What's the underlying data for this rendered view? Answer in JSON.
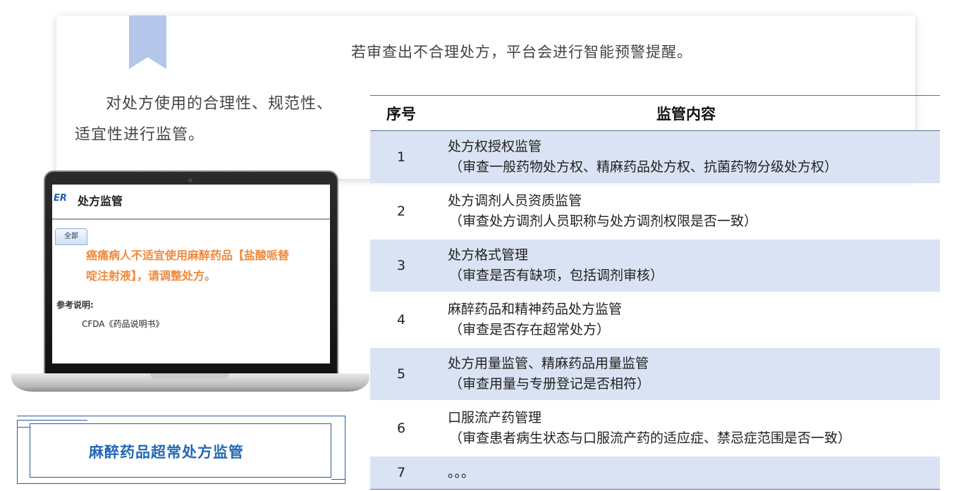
{
  "card": {
    "warning_text": "若审查出不合理处方，平台会进行智能预警提醒。",
    "intro_text": "对处方使用的合理性、规范性、适宜性进行监管。"
  },
  "table": {
    "header_num": "序号",
    "header_content": "监管内容",
    "rows": [
      {
        "num": "1",
        "title": "处方权授权监管",
        "detail": "（审查一般药物处方权、精麻药品处方权、抗菌药物分级处方权）"
      },
      {
        "num": "2",
        "title": "处方调剂人员资质监管",
        "detail": "（审查处方调剂人员职称与处方调剂权限是否一致）"
      },
      {
        "num": "3",
        "title": "处方格式管理",
        "detail": "（审查是否有缺项，包括调剂审核）"
      },
      {
        "num": "4",
        "title": "麻醉药品和精神药品处方监管",
        "detail": "（审查是否存在超常处方）"
      },
      {
        "num": "5",
        "title": "处方用量监管、精麻药品用量监管",
        "detail": "（审查用量与专册登记是否相符）"
      },
      {
        "num": "6",
        "title": "口服流产药管理",
        "detail": "（审查患者病生状态与口服流产药的适应症、禁忌症范围是否一致）"
      },
      {
        "num": "7",
        "title": "。。。",
        "detail": ""
      }
    ]
  },
  "screen": {
    "logo": "ER",
    "title": "处方监管",
    "tab": "全部",
    "warning": "癌痛病人不适宜使用麻醉药品【盐酸哌替啶注射液】，请调整处方。",
    "ref_label": "参考说明:",
    "ref_value": "CFDA《药品说明书》"
  },
  "bottom_label": "麻醉药品超常处方监管",
  "colors": {
    "accent": "#2468b4",
    "row_shade": "#dae3f3",
    "bookmark": "#b4c6ea",
    "warning": "#f08a3c"
  }
}
